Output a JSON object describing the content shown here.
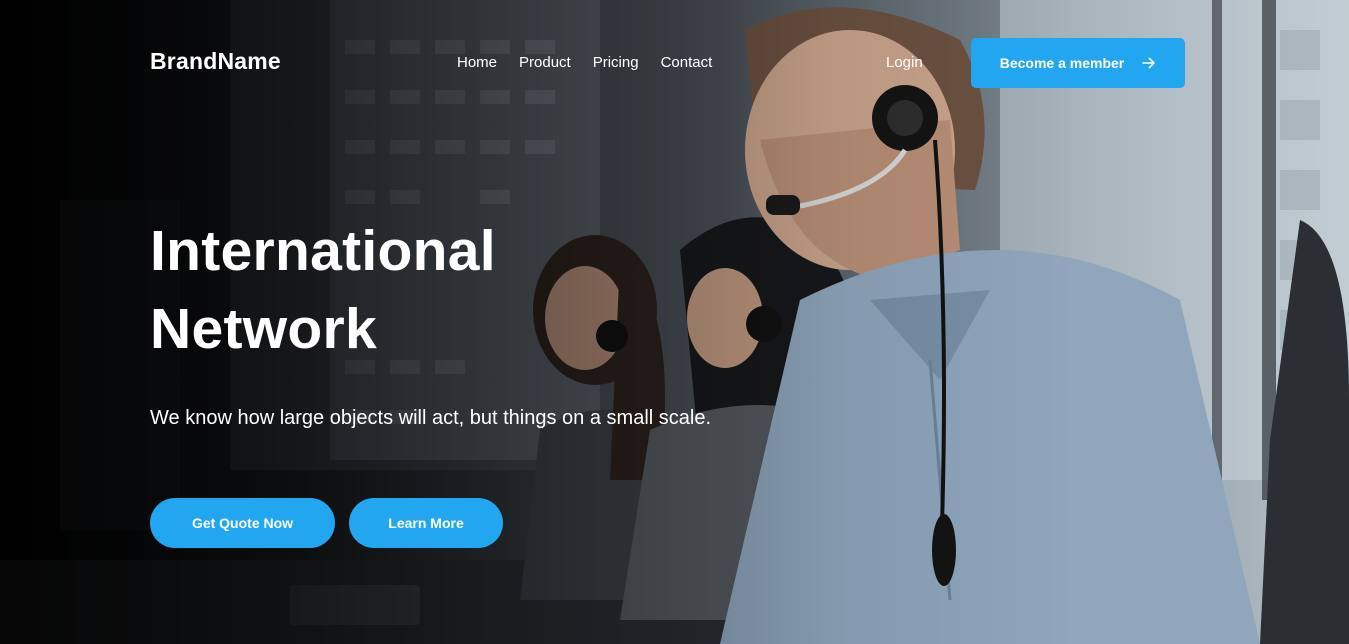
{
  "nav": {
    "brand": "BrandName",
    "links": [
      "Home",
      "Product",
      "Pricing",
      "Contact"
    ],
    "login": "Login",
    "member_button": "Become a member",
    "member_button_icon": "arrow-right-icon"
  },
  "hero": {
    "title_line1": "International",
    "title_line2": "Network",
    "subtitle": "We know how large objects will act, but things on a small scale.",
    "primary_button": "Get Quote Now",
    "secondary_button": "Learn More",
    "background_image": "call-center-agents-with-headsets-photo"
  },
  "colors": {
    "accent": "#23a6f0",
    "text": "#ffffff"
  }
}
